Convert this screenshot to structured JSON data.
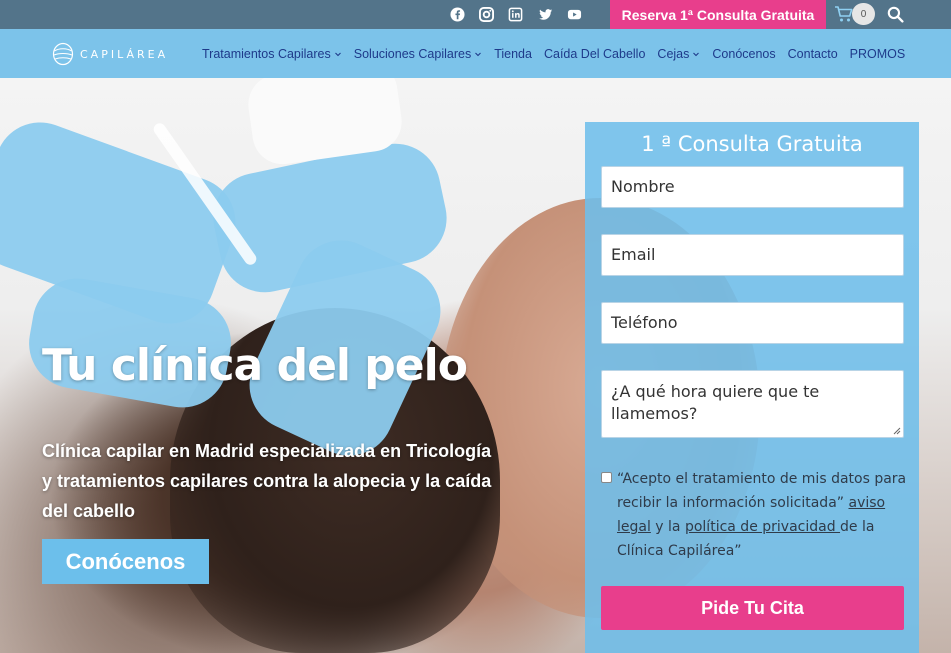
{
  "topbar": {
    "social": [
      "facebook-icon",
      "instagram-icon",
      "linkedin-icon",
      "twitter-icon",
      "youtube-icon"
    ],
    "reserve_label": "Reserva 1ª Consulta Gratuita",
    "cart_count": "0"
  },
  "brand": {
    "logo_text": "CAPILÁREA"
  },
  "nav": {
    "items": [
      {
        "label": "Tratamientos Capilares",
        "dropdown": true
      },
      {
        "label": "Soluciones Capilares",
        "dropdown": true
      },
      {
        "label": "Tienda",
        "dropdown": false
      },
      {
        "label": "Caída Del Cabello",
        "dropdown": false
      },
      {
        "label": "Cejas",
        "dropdown": true
      },
      {
        "label": "Conócenos",
        "dropdown": false
      },
      {
        "label": "Contacto",
        "dropdown": false
      },
      {
        "label": "PROMOS",
        "dropdown": false
      }
    ]
  },
  "hero": {
    "title": "Tu clínica del pelo",
    "subtitle": "Clínica capilar en Madrid especializada en Tricología y tratamientos capilares contra la alopecia y la caída del cabello",
    "button_label": "Conócenos"
  },
  "form": {
    "title": "1 ª Consulta Gratuita",
    "name_placeholder": "Nombre",
    "email_placeholder": "Email",
    "phone_placeholder": "Teléfono",
    "time_placeholder": "¿A qué hora quiere que te llamemos?",
    "consent_pre": "“Acepto el tratamiento de mis datos para recibir la información solicitada” ",
    "consent_link1": "aviso legal",
    "consent_mid": " y la ",
    "consent_link2": "política de privacidad ",
    "consent_post": "de la Clínica Capilárea”",
    "submit_label": "Pide Tu Cita"
  },
  "colors": {
    "topbar": "#53748a",
    "navbar": "#7cc3ea",
    "accent_pink": "#e83e8c",
    "nav_text": "#1e3a8a",
    "panel": "#6ebeeb"
  }
}
